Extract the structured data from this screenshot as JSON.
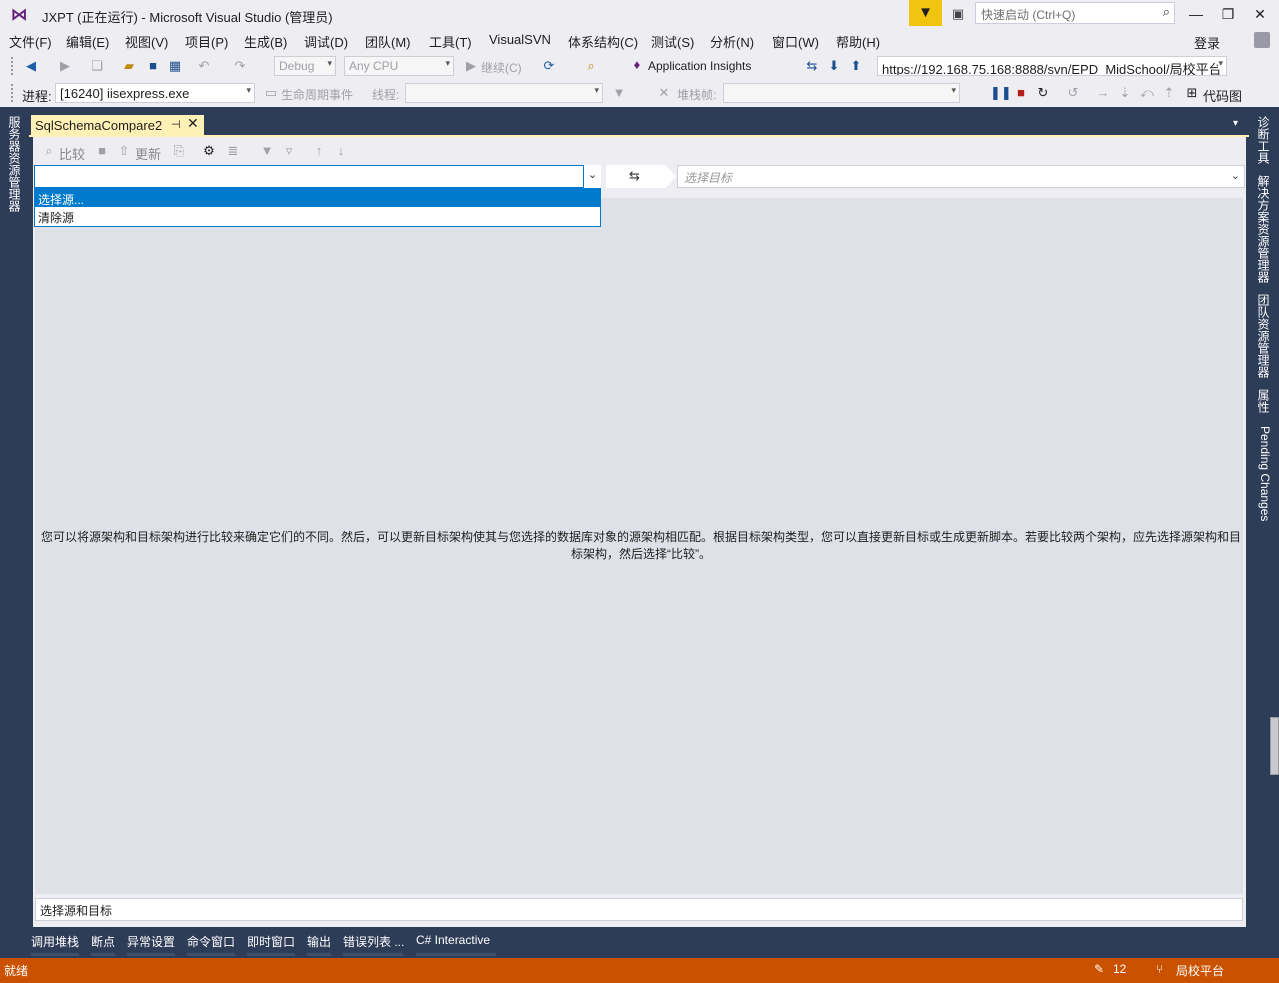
{
  "titlebar": {
    "title": "JXPT (正在运行) - Microsoft Visual Studio (管理员)",
    "quick_launch_placeholder": "快速启动 (Ctrl+Q)"
  },
  "menu": {
    "items": [
      "文件(F)",
      "编辑(E)",
      "视图(V)",
      "项目(P)",
      "生成(B)",
      "调试(D)",
      "团队(M)",
      "工具(T)",
      "VisualSVN",
      "体系结构(C)",
      "测试(S)",
      "分析(N)",
      "窗口(W)",
      "帮助(H)"
    ],
    "login": "登录"
  },
  "toolbar1": {
    "config": "Debug",
    "platform": "Any CPU",
    "continue": "继续(C)",
    "app_insights": "Application Insights",
    "svn_url": "https://192.168.75.168:8888/svn/EPD_MidSchool/局校平台"
  },
  "toolbar2": {
    "process_label": "进程:",
    "process_value": "[16240] iisexpress.exe",
    "lifecycle": "生命周期事件",
    "thread_label": "线程:",
    "stackframe_label": "堆栈帧:",
    "code_map": "代码图"
  },
  "left_tab": {
    "label": "服务器资源管理器"
  },
  "right_tabs": [
    "诊断工具",
    "解决方案资源管理器",
    "团队资源管理器",
    "属性",
    "Pending Changes"
  ],
  "doc_tab": {
    "title": "SqlSchemaCompare2"
  },
  "schema_toolbar": {
    "compare": "比较",
    "update": "更新"
  },
  "source_dropdown": {
    "items": [
      "选择源...",
      "清除源"
    ]
  },
  "target": {
    "placeholder": "选择目标"
  },
  "description": "您可以将源架构和目标架构进行比较来确定它们的不同。然后，可以更新目标架构使其与您选择的数据库对象的源架构相匹配。根据目标架构类型，您可以直接更新目标或生成更新脚本。若要比较两个架构，应先选择源架构和目标架构，然后选择“比较”。",
  "status_field": "选择源和目标",
  "bottom_tabs": [
    "调用堆栈",
    "断点",
    "异常设置",
    "命令窗口",
    "即时窗口",
    "输出",
    "错误列表 ...",
    "C# Interactive"
  ],
  "statusbar": {
    "ready": "就绪",
    "pending_count": "12",
    "branch": "局校平台"
  },
  "colors": {
    "accent": "#007acc",
    "status_bar": "#ca5100",
    "tab_active": "#fff0b5",
    "chrome_dark": "#2d3c57"
  }
}
